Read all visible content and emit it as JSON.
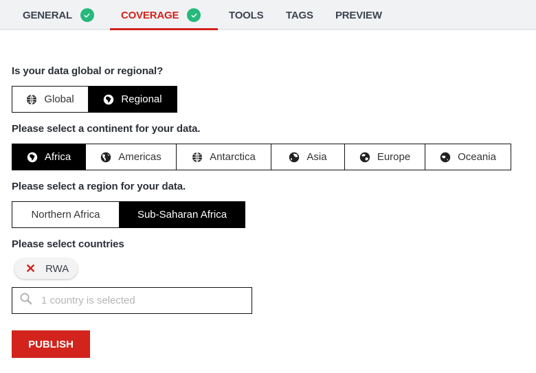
{
  "tabs": [
    {
      "label": "GENERAL",
      "completed": true,
      "active": false
    },
    {
      "label": "COVERAGE",
      "completed": true,
      "active": true
    },
    {
      "label": "TOOLS",
      "completed": false,
      "active": false
    },
    {
      "label": "TAGS",
      "completed": false,
      "active": false
    },
    {
      "label": "PREVIEW",
      "completed": false,
      "active": false
    }
  ],
  "scope": {
    "question": "Is your data global or regional?",
    "options": [
      {
        "label": "Global",
        "icon": "globe-grid-icon",
        "selected": false
      },
      {
        "label": "Regional",
        "icon": "globe-africa-icon",
        "selected": true
      }
    ]
  },
  "continent": {
    "question": "Please select a continent for your data.",
    "options": [
      {
        "label": "Africa",
        "icon": "globe-africa-icon",
        "selected": true
      },
      {
        "label": "Americas",
        "icon": "globe-americas-icon",
        "selected": false
      },
      {
        "label": "Antarctica",
        "icon": "globe-grid-icon",
        "selected": false
      },
      {
        "label": "Asia",
        "icon": "globe-asia-icon",
        "selected": false
      },
      {
        "label": "Europe",
        "icon": "globe-europe-icon",
        "selected": false
      },
      {
        "label": "Oceania",
        "icon": "globe-oceania-icon",
        "selected": false
      }
    ]
  },
  "region": {
    "question": "Please select a region for your data.",
    "options": [
      {
        "label": "Northern Africa",
        "selected": false
      },
      {
        "label": "Sub-Saharan Africa",
        "selected": true
      }
    ]
  },
  "countries": {
    "question": "Please select countries",
    "selected": [
      "RWA"
    ],
    "search_placeholder": "1 country is selected",
    "search_value": ""
  },
  "publish_label": "PUBLISH",
  "colors": {
    "accent": "#d2231c",
    "success": "#27b97c",
    "tab_text": "#3d4350",
    "tabbar_bg": "#f1f2f4"
  }
}
